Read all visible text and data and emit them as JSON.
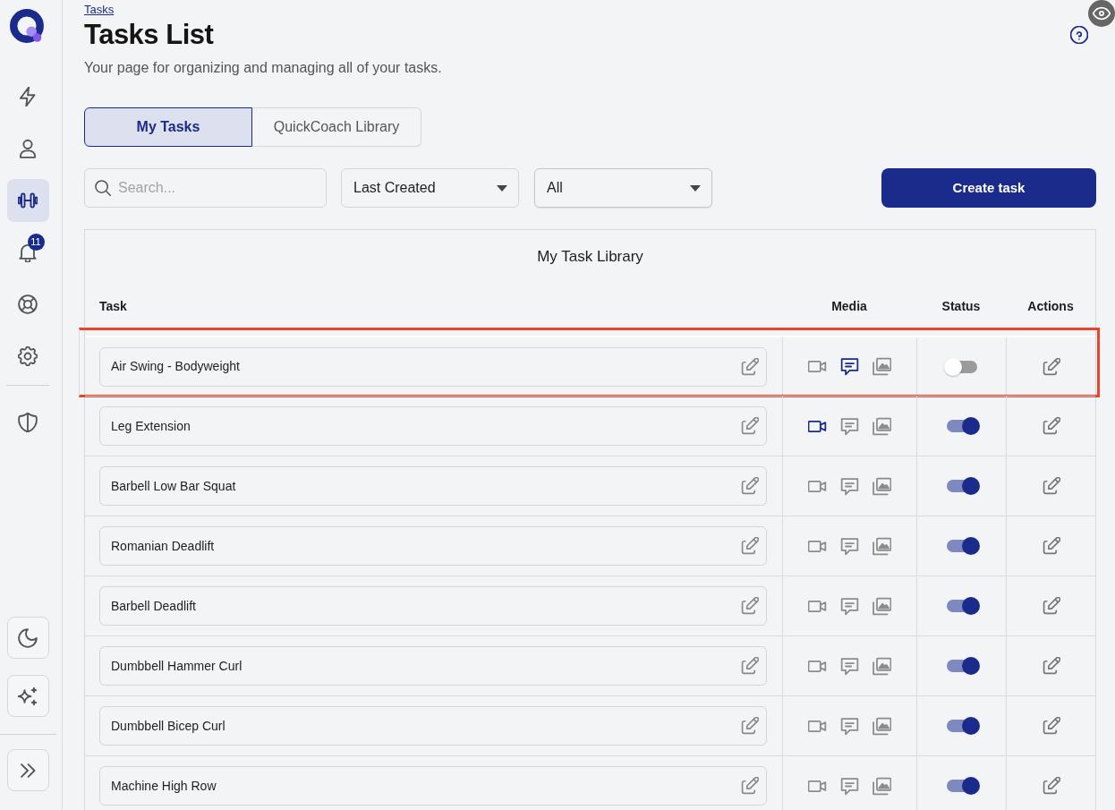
{
  "sidebar": {
    "items": [
      {
        "selected": false
      },
      {
        "selected": false
      },
      {
        "selected": true
      },
      {
        "selected": false,
        "badge": "11"
      },
      {
        "selected": false
      },
      {
        "selected": false
      },
      {
        "selected": false
      }
    ]
  },
  "breadcrumb": "Tasks",
  "page": {
    "title": "Tasks List",
    "subtitle": "Your page for organizing and managing all of your tasks."
  },
  "tabs": [
    {
      "label": "My Tasks",
      "selected": true
    },
    {
      "label": "QuickCoach Library",
      "selected": false
    }
  ],
  "filters": {
    "search": {
      "placeholder": "Search..."
    },
    "sort": {
      "value": "Last Created"
    },
    "status_filter": {
      "value": "All"
    }
  },
  "create_button": "Create task",
  "table": {
    "title": "My Task Library",
    "columns": [
      "Task",
      "Media",
      "Status",
      "Actions"
    ],
    "rows": [
      {
        "task": "Air Swing - Bodyweight",
        "has_video": false,
        "has_notes": true,
        "has_image": false,
        "active": false,
        "highlighted": true
      },
      {
        "task": "Leg Extension",
        "has_video": true,
        "has_notes": false,
        "has_image": false,
        "active": true,
        "highlighted": false
      },
      {
        "task": "Barbell Low Bar Squat",
        "has_video": false,
        "has_notes": false,
        "has_image": false,
        "active": true,
        "highlighted": false
      },
      {
        "task": "Romanian Deadlift",
        "has_video": false,
        "has_notes": false,
        "has_image": false,
        "active": true,
        "highlighted": false
      },
      {
        "task": "Barbell Deadlift",
        "has_video": false,
        "has_notes": false,
        "has_image": false,
        "active": true,
        "highlighted": false
      },
      {
        "task": "Dumbbell Hammer Curl",
        "has_video": false,
        "has_notes": false,
        "has_image": false,
        "active": true,
        "highlighted": false
      },
      {
        "task": "Dumbbell Bicep Curl",
        "has_video": false,
        "has_notes": false,
        "has_image": false,
        "active": true,
        "highlighted": false
      },
      {
        "task": "Machine High Row",
        "has_video": false,
        "has_notes": false,
        "has_image": false,
        "active": true,
        "highlighted": false
      }
    ]
  }
}
